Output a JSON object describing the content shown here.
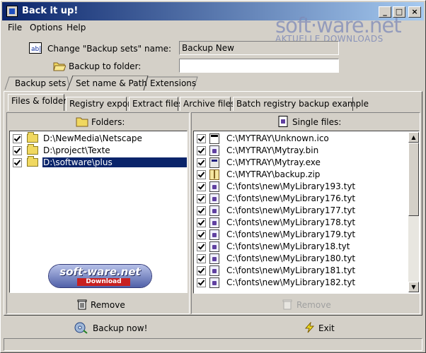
{
  "window": {
    "title": "Back it up!",
    "buttons": [
      "_",
      "□",
      "×"
    ]
  },
  "menu": [
    "File",
    "Options",
    "Help"
  ],
  "watermark": {
    "title": "soft·ware.net",
    "subtitle": "AKTUELLE DOWNLOADS"
  },
  "form": {
    "name_label": "Change \"Backup sets\" name:",
    "name_value": "Backup New",
    "folder_label": "Backup to folder:",
    "folder_value": ""
  },
  "main_tabs": [
    "Backup sets",
    "Set name & Path",
    "Extensions"
  ],
  "sub_tabs": [
    "Files & folders",
    "Registry export",
    "Extract files",
    "Archive files",
    "Batch registry backup example"
  ],
  "folders": {
    "header": "Folders:",
    "items": [
      {
        "path": "D:\\NewMedia\\Netscape",
        "checked": true,
        "selected": false
      },
      {
        "path": "D:\\project\\Texte",
        "checked": true,
        "selected": false
      },
      {
        "path": "D:\\software\\plus",
        "checked": true,
        "selected": true
      }
    ],
    "remove_label": "Remove"
  },
  "files": {
    "header": "Single files:",
    "items": [
      {
        "path": "C:\\MYTRAY\\Unknown.ico",
        "checked": true,
        "icon": "ico"
      },
      {
        "path": "C:\\MYTRAY\\Mytray.bin",
        "checked": true,
        "icon": "tyt"
      },
      {
        "path": "C:\\MYTRAY\\Mytray.exe",
        "checked": true,
        "icon": "app"
      },
      {
        "path": "C:\\MYTRAY\\backup.zip",
        "checked": true,
        "icon": "zip"
      },
      {
        "path": "C:\\fonts\\new\\MyLibrary193.tyt",
        "checked": true,
        "icon": "tyt"
      },
      {
        "path": "C:\\fonts\\new\\MyLibrary176.tyt",
        "checked": true,
        "icon": "tyt"
      },
      {
        "path": "C:\\fonts\\new\\MyLibrary177.tyt",
        "checked": true,
        "icon": "tyt"
      },
      {
        "path": "C:\\fonts\\new\\MyLibrary178.tyt",
        "checked": true,
        "icon": "tyt"
      },
      {
        "path": "C:\\fonts\\new\\MyLibrary179.tyt",
        "checked": true,
        "icon": "tyt"
      },
      {
        "path": "C:\\fonts\\new\\MyLibrary18.tyt",
        "checked": true,
        "icon": "tyt"
      },
      {
        "path": "C:\\fonts\\new\\MyLibrary180.tyt",
        "checked": true,
        "icon": "tyt"
      },
      {
        "path": "C:\\fonts\\new\\MyLibrary181.tyt",
        "checked": true,
        "icon": "tyt"
      },
      {
        "path": "C:\\fonts\\new\\MyLibrary182.tyt",
        "checked": true,
        "icon": "tyt"
      }
    ],
    "remove_label": "Remove"
  },
  "logo": {
    "title": "soft-ware.net",
    "badge": "Download"
  },
  "actions": {
    "backup": "Backup now!",
    "exit": "Exit"
  }
}
